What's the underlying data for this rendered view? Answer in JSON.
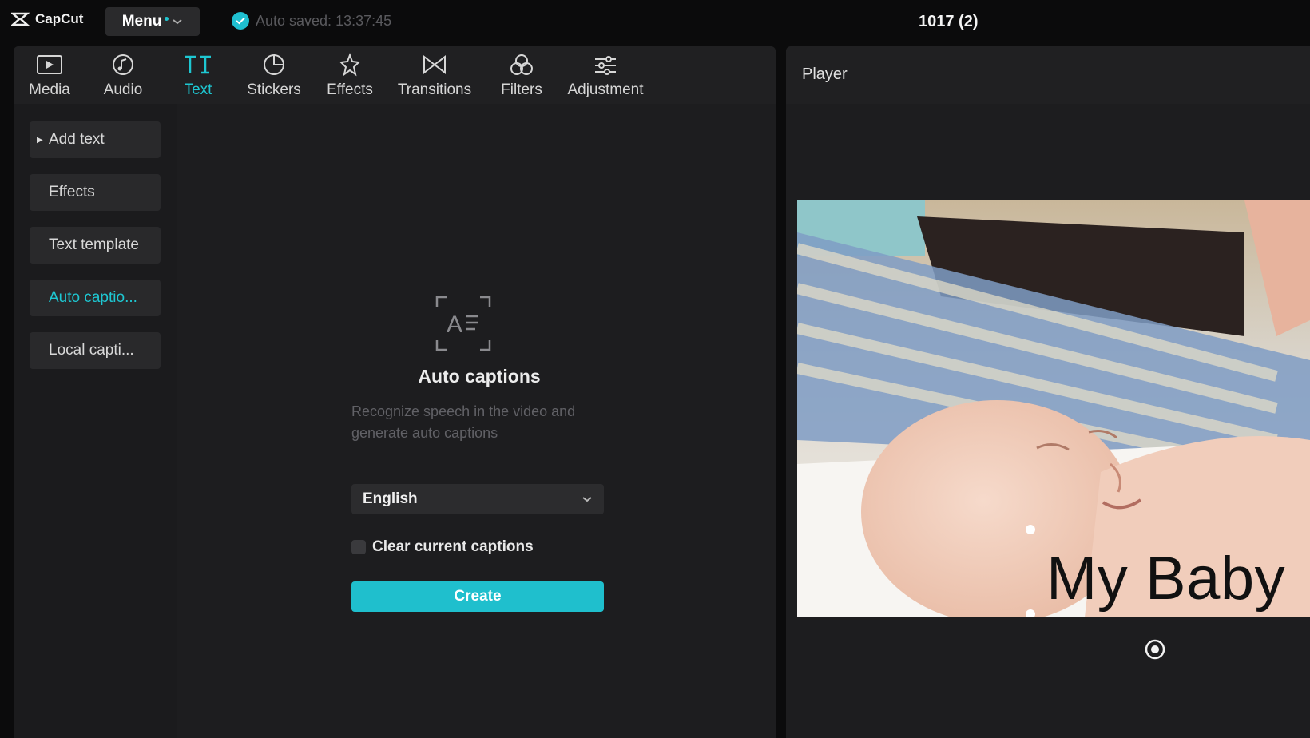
{
  "app": {
    "logo_text": "CapCut",
    "menu_label": "Menu",
    "autosave_text": "Auto saved: 13:37:45",
    "project_title": "1017 (2)"
  },
  "tabs": [
    {
      "label": "Media",
      "icon": "media-icon"
    },
    {
      "label": "Audio",
      "icon": "audio-icon"
    },
    {
      "label": "Text",
      "icon": "text-icon",
      "active": true
    },
    {
      "label": "Stickers",
      "icon": "stickers-icon"
    },
    {
      "label": "Effects",
      "icon": "effects-icon"
    },
    {
      "label": "Transitions",
      "icon": "transitions-icon"
    },
    {
      "label": "Filters",
      "icon": "filters-icon"
    },
    {
      "label": "Adjustment",
      "icon": "adjustment-icon"
    }
  ],
  "sidebar": {
    "items": [
      {
        "label": "Add text"
      },
      {
        "label": "Effects"
      },
      {
        "label": "Text template"
      },
      {
        "label": "Auto captio...",
        "active": true
      },
      {
        "label": "Local capti..."
      }
    ]
  },
  "auto_captions": {
    "title": "Auto captions",
    "description": "Recognize speech in the video and generate auto captions",
    "language": "English",
    "clear_label": "Clear current captions",
    "create_label": "Create"
  },
  "player": {
    "title": "Player",
    "caption_text": "My Baby"
  },
  "colors": {
    "accent": "#1ec7d2",
    "background": "#0b0b0c",
    "panel": "#1d1d1f"
  }
}
